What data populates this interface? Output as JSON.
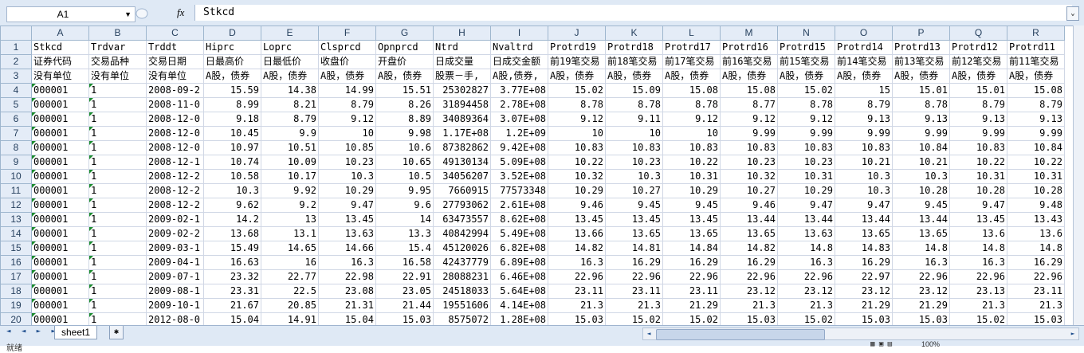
{
  "namebox": {
    "value": "A1",
    "arrow": "▼"
  },
  "formula": {
    "fx": "fx",
    "value": "Stkcd",
    "expand": "⌄"
  },
  "columns": [
    "A",
    "B",
    "C",
    "D",
    "E",
    "F",
    "G",
    "H",
    "I",
    "J",
    "K",
    "L",
    "M",
    "N",
    "O",
    "P",
    "Q",
    "R"
  ],
  "rows": [
    {
      "n": "1",
      "cells": [
        "Stkcd",
        "Trdvar",
        "Trddt",
        "Hiprc",
        "Loprc",
        "Clsprcd",
        "Opnprcd",
        "Ntrd",
        "Nvaltrd",
        "Protrd19",
        "Protrd18",
        "Protrd17",
        "Protrd16",
        "Protrd15",
        "Protrd14",
        "Protrd13",
        "Protrd12",
        "Protrd11"
      ]
    },
    {
      "n": "2",
      "cells": [
        "证券代码",
        "交易品种",
        "交易日期",
        "日最高价",
        "日最低价",
        "收盘价",
        "开盘价",
        "日成交量",
        "日成交金额",
        "前19笔交易",
        "前18笔交易",
        "前17笔交易",
        "前16笔交易",
        "前15笔交易",
        "前14笔交易",
        "前13笔交易",
        "前12笔交易",
        "前11笔交易"
      ]
    },
    {
      "n": "3",
      "cells": [
        "没有单位",
        "没有单位",
        "没有单位",
        "A股，债券",
        "A股，债券",
        "A股，债券",
        "A股，债券",
        "股票－手,",
        "A股,债券,",
        "A股，债券",
        "A股，债券",
        "A股，债券",
        "A股，债券",
        "A股，债券",
        "A股，债券",
        "A股，债券",
        "A股，债券",
        "A股，债券"
      ]
    },
    {
      "n": "4",
      "cells": [
        "000001",
        "1",
        "2008-09-2",
        "15.59",
        "14.38",
        "14.99",
        "15.51",
        "25302827",
        "3.77E+08",
        "15.02",
        "15.09",
        "15.08",
        "15.08",
        "15.02",
        "15",
        "15.01",
        "15.01",
        "15.08"
      ]
    },
    {
      "n": "5",
      "cells": [
        "000001",
        "1",
        "2008-11-0",
        "8.99",
        "8.21",
        "8.79",
        "8.26",
        "31894458",
        "2.78E+08",
        "8.78",
        "8.78",
        "8.78",
        "8.77",
        "8.78",
        "8.79",
        "8.78",
        "8.79",
        "8.79"
      ]
    },
    {
      "n": "6",
      "cells": [
        "000001",
        "1",
        "2008-12-0",
        "9.18",
        "8.79",
        "9.12",
        "8.89",
        "34089364",
        "3.07E+08",
        "9.12",
        "9.11",
        "9.12",
        "9.12",
        "9.12",
        "9.13",
        "9.13",
        "9.13",
        "9.13"
      ]
    },
    {
      "n": "7",
      "cells": [
        "000001",
        "1",
        "2008-12-0",
        "10.45",
        "9.9",
        "10",
        "9.98",
        "1.17E+08",
        "1.2E+09",
        "10",
        "10",
        "10",
        "9.99",
        "9.99",
        "9.99",
        "9.99",
        "9.99",
        "9.99"
      ]
    },
    {
      "n": "8",
      "cells": [
        "000001",
        "1",
        "2008-12-0",
        "10.97",
        "10.51",
        "10.85",
        "10.6",
        "87382862",
        "9.42E+08",
        "10.83",
        "10.83",
        "10.83",
        "10.83",
        "10.83",
        "10.83",
        "10.84",
        "10.83",
        "10.84"
      ]
    },
    {
      "n": "9",
      "cells": [
        "000001",
        "1",
        "2008-12-1",
        "10.74",
        "10.09",
        "10.23",
        "10.65",
        "49130134",
        "5.09E+08",
        "10.22",
        "10.23",
        "10.22",
        "10.23",
        "10.23",
        "10.21",
        "10.21",
        "10.22",
        "10.22"
      ]
    },
    {
      "n": "10",
      "cells": [
        "000001",
        "1",
        "2008-12-2",
        "10.58",
        "10.17",
        "10.3",
        "10.5",
        "34056207",
        "3.52E+08",
        "10.32",
        "10.3",
        "10.31",
        "10.32",
        "10.31",
        "10.3",
        "10.3",
        "10.31",
        "10.31"
      ]
    },
    {
      "n": "11",
      "cells": [
        "000001",
        "1",
        "2008-12-2",
        "10.3",
        "9.92",
        "10.29",
        "9.95",
        "7660915",
        "77573348",
        "10.29",
        "10.27",
        "10.29",
        "10.27",
        "10.29",
        "10.3",
        "10.28",
        "10.28",
        "10.28"
      ]
    },
    {
      "n": "12",
      "cells": [
        "000001",
        "1",
        "2008-12-2",
        "9.62",
        "9.2",
        "9.47",
        "9.6",
        "27793062",
        "2.61E+08",
        "9.46",
        "9.45",
        "9.45",
        "9.46",
        "9.47",
        "9.47",
        "9.45",
        "9.47",
        "9.48"
      ]
    },
    {
      "n": "13",
      "cells": [
        "000001",
        "1",
        "2009-02-1",
        "14.2",
        "13",
        "13.45",
        "14",
        "63473557",
        "8.62E+08",
        "13.45",
        "13.45",
        "13.45",
        "13.44",
        "13.44",
        "13.44",
        "13.44",
        "13.45",
        "13.43"
      ]
    },
    {
      "n": "14",
      "cells": [
        "000001",
        "1",
        "2009-02-2",
        "13.68",
        "13.1",
        "13.63",
        "13.3",
        "40842994",
        "5.49E+08",
        "13.66",
        "13.65",
        "13.65",
        "13.65",
        "13.63",
        "13.65",
        "13.65",
        "13.6",
        "13.6"
      ]
    },
    {
      "n": "15",
      "cells": [
        "000001",
        "1",
        "2009-03-1",
        "15.49",
        "14.65",
        "14.66",
        "15.4",
        "45120026",
        "6.82E+08",
        "14.82",
        "14.81",
        "14.84",
        "14.82",
        "14.8",
        "14.83",
        "14.8",
        "14.8",
        "14.8"
      ]
    },
    {
      "n": "16",
      "cells": [
        "000001",
        "1",
        "2009-04-1",
        "16.63",
        "16",
        "16.3",
        "16.58",
        "42437779",
        "6.89E+08",
        "16.3",
        "16.29",
        "16.29",
        "16.29",
        "16.3",
        "16.29",
        "16.3",
        "16.3",
        "16.29"
      ]
    },
    {
      "n": "17",
      "cells": [
        "000001",
        "1",
        "2009-07-1",
        "23.32",
        "22.77",
        "22.98",
        "22.91",
        "28088231",
        "6.46E+08",
        "22.96",
        "22.96",
        "22.96",
        "22.96",
        "22.96",
        "22.97",
        "22.96",
        "22.96",
        "22.96"
      ]
    },
    {
      "n": "18",
      "cells": [
        "000001",
        "1",
        "2009-08-1",
        "23.31",
        "22.5",
        "23.08",
        "23.05",
        "24518033",
        "5.64E+08",
        "23.11",
        "23.11",
        "23.11",
        "23.12",
        "23.12",
        "23.12",
        "23.12",
        "23.13",
        "23.11"
      ]
    },
    {
      "n": "19",
      "cells": [
        "000001",
        "1",
        "2009-10-1",
        "21.67",
        "20.85",
        "21.31",
        "21.44",
        "19551606",
        "4.14E+08",
        "21.3",
        "21.3",
        "21.29",
        "21.3",
        "21.3",
        "21.29",
        "21.29",
        "21.3",
        "21.3"
      ]
    },
    {
      "n": "20",
      "cells": [
        "000001",
        "1",
        "2012-08-0",
        "15.04",
        "14.91",
        "15.04",
        "15.03",
        "8575072",
        "1.28E+08",
        "15.03",
        "15.02",
        "15.02",
        "15.03",
        "15.02",
        "15.03",
        "15.03",
        "15.02",
        "15.03"
      ]
    }
  ],
  "sheet_tab": "sheet1",
  "nav_buttons": "◄ ◄ ► ►",
  "status": "就绪",
  "zoom": "100%"
}
